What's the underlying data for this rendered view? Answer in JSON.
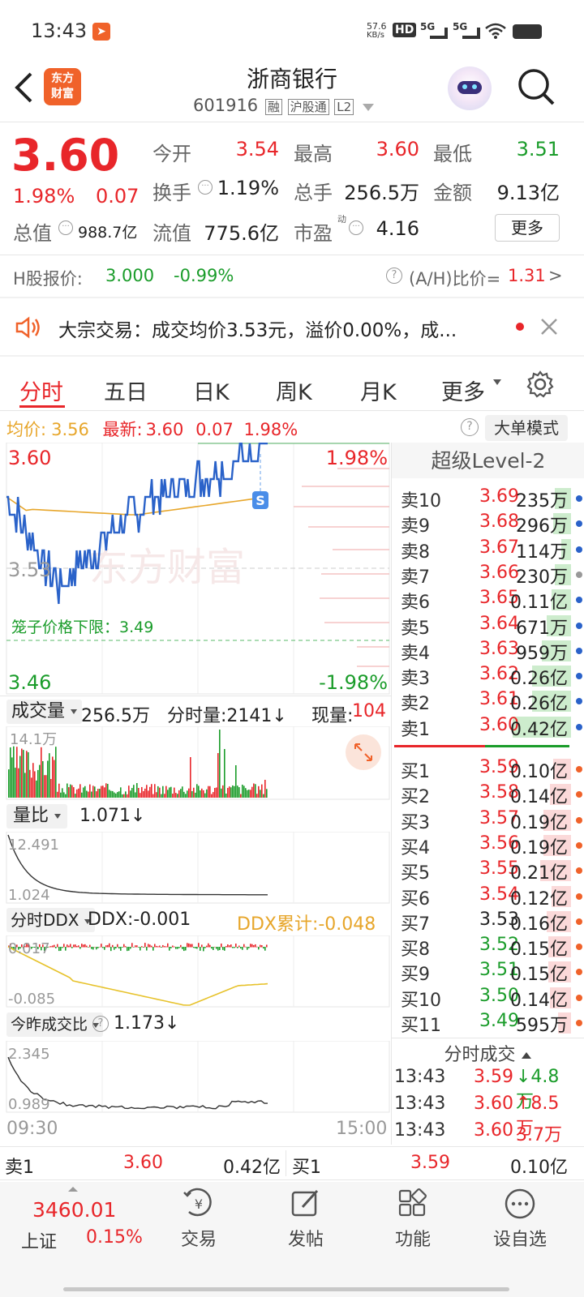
{
  "status_bar": {
    "time": "13:43",
    "net_speed": "57.6",
    "net_unit": "KB/s",
    "hd": "HD",
    "sig1": "5G",
    "sig2": "5G"
  },
  "header": {
    "back": "<",
    "logo_line1": "东方",
    "logo_line2": "财富",
    "title": "浙商银行",
    "code": "601916",
    "badges": [
      "融",
      "沪股通",
      "L2"
    ]
  },
  "quote": {
    "price": "3.60",
    "pct": "1.98%",
    "chg": "0.07",
    "open_label": "今开",
    "open": "3.54",
    "high_label": "最高",
    "high": "3.60",
    "low_label": "最低",
    "low": "3.51",
    "turnover_label": "换手",
    "turnover": "1.19%",
    "vol_label": "总手",
    "vol": "256.5万",
    "amount_label": "金额",
    "amount": "9.13亿",
    "mcap_label": "总值",
    "mcap": "988.7亿",
    "float_label": "流值",
    "float": "775.6亿",
    "pe_label": "市盈",
    "pe_sup": "动",
    "pe": "4.16",
    "more": "更多"
  },
  "hshare": {
    "label": "H股报价:",
    "price": "3.000",
    "pct": "-0.99%",
    "ratio_label": "(A/H)比价=",
    "ratio": "1.31",
    ">": ">"
  },
  "notice": {
    "text": "大宗交易：成交均价3.53元，溢价0.00%，成..."
  },
  "tabs": [
    "分时",
    "五日",
    "日K",
    "周K",
    "月K",
    "更多"
  ],
  "info_line": {
    "avg_label": "均价:",
    "avg": "3.56",
    "last_label": "最新:",
    "last": "3.60",
    "chg": "0.07",
    "pct": "1.98%",
    "mode": "大单模式"
  },
  "chart": {
    "y_top": "3.60",
    "y_mid": "3.53",
    "y_bot": "3.46",
    "pct_top": "1.98%",
    "pct_bot": "-1.98%",
    "limit_label": "笼子价格下限：3.49",
    "watermark": "东方财富",
    "x_start": "09:30",
    "x_end": "15:00",
    "s_mark": "S"
  },
  "volume": {
    "label": "成交量",
    "total": "256.5万",
    "fs_label": "分时量:2141↓",
    "cur_label": "现量:",
    "cur": "104",
    "max": "14.1万"
  },
  "ratio": {
    "label": "量比",
    "value": "1.071↓",
    "max": "12.491",
    "min": "1.024"
  },
  "ddx": {
    "label": "分时DDX",
    "value": "DDX:-0.001",
    "cum": "DDX累计:-0.048",
    "top": "0.017",
    "bot": "-0.085"
  },
  "yratio": {
    "label": "今昨成交比",
    "value": "1.173↓",
    "max": "2.345",
    "min": "0.989"
  },
  "level2": {
    "title": "超级Level-2",
    "asks": [
      {
        "l": "卖10",
        "p": "3.69",
        "v": "235万",
        "w": 20
      },
      {
        "l": "卖9",
        "p": "3.68",
        "v": "296万",
        "w": 22
      },
      {
        "l": "卖8",
        "p": "3.67",
        "v": "114万",
        "w": 12
      },
      {
        "l": "卖7",
        "p": "3.66",
        "v": "230万",
        "w": 20
      },
      {
        "l": "卖6",
        "p": "3.65",
        "v": "0.11亿",
        "w": 24
      },
      {
        "l": "卖5",
        "p": "3.64",
        "v": "671万",
        "w": 30
      },
      {
        "l": "卖4",
        "p": "3.63",
        "v": "959万",
        "w": 36
      },
      {
        "l": "卖3",
        "p": "3.62",
        "v": "0.26亿",
        "w": 48
      },
      {
        "l": "卖2",
        "p": "3.61",
        "v": "0.26亿",
        "w": 48
      },
      {
        "l": "卖1",
        "p": "3.60",
        "v": "0.42亿",
        "w": 72
      }
    ],
    "bids": [
      {
        "l": "买1",
        "p": "3.59",
        "v": "0.10亿",
        "w": 22
      },
      {
        "l": "买2",
        "p": "3.58",
        "v": "0.14亿",
        "w": 26
      },
      {
        "l": "买3",
        "p": "3.57",
        "v": "0.19亿",
        "w": 34
      },
      {
        "l": "买4",
        "p": "3.56",
        "v": "0.19亿",
        "w": 34
      },
      {
        "l": "买5",
        "p": "3.55",
        "v": "0.21亿",
        "w": 38
      },
      {
        "l": "买6",
        "p": "3.54",
        "v": "0.12亿",
        "w": 24
      },
      {
        "l": "买7",
        "p": "3.53",
        "v": "0.16亿",
        "w": 30
      },
      {
        "l": "买8",
        "p": "3.52",
        "v": "0.15亿",
        "w": 28
      },
      {
        "l": "买9",
        "p": "3.51",
        "v": "0.15亿",
        "w": 28
      },
      {
        "l": "买10",
        "p": "3.50",
        "v": "0.14亿",
        "w": 26
      },
      {
        "l": "买11",
        "p": "3.49",
        "v": "595万",
        "w": 16
      }
    ],
    "trades_title": "分时成交",
    "trades": [
      {
        "t": "13:43",
        "p": "3.59",
        "v": "↓4.8万"
      },
      {
        "t": "13:43",
        "p": "3.60",
        "v": "↑8.5万"
      },
      {
        "t": "13:43",
        "p": "3.60",
        "v": "3.7万"
      }
    ]
  },
  "bottom_quote": {
    "ask_label": "卖1",
    "ask_p": "3.60",
    "ask_v": "0.42亿",
    "bid_label": "买1",
    "bid_p": "3.59",
    "bid_v": "0.10亿"
  },
  "index": {
    "value": "3460.01",
    "name": "上证",
    "pct": "0.15%"
  },
  "nav": [
    "交易",
    "发帖",
    "功能",
    "设自选"
  ],
  "colors": {
    "up": "#e8262a",
    "down": "#1a9c2a",
    "price_line": "#2a62c9",
    "avg_line": "#e7a62b"
  }
}
